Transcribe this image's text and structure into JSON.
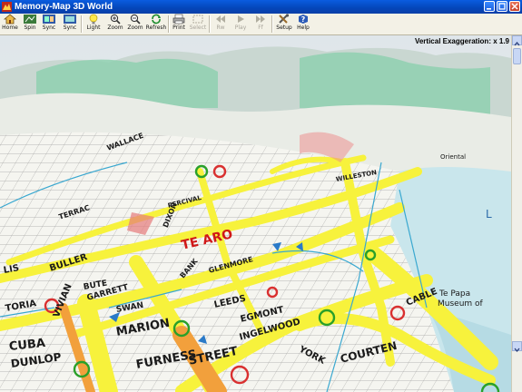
{
  "window": {
    "title": "Memory-Map 3D World"
  },
  "toolbar": {
    "buttons": [
      {
        "label": "Home",
        "icon": "home-icon",
        "enabled": true
      },
      {
        "label": "Spin",
        "icon": "spin-icon",
        "enabled": true
      },
      {
        "label": "Sync",
        "icon": "sync-icon",
        "enabled": true
      },
      {
        "label": "Sync",
        "icon": "sync-icon",
        "enabled": true
      },
      {
        "label": "Light",
        "icon": "light-bulb-icon",
        "enabled": true
      },
      {
        "label": "Zoom",
        "icon": "zoom-in-icon",
        "enabled": true
      },
      {
        "label": "Zoom",
        "icon": "zoom-out-icon",
        "enabled": true
      },
      {
        "label": "Refresh",
        "icon": "refresh-icon",
        "enabled": true
      },
      {
        "label": "Print",
        "icon": "print-icon",
        "enabled": true
      },
      {
        "label": "Select",
        "icon": "select-icon",
        "enabled": false
      },
      {
        "label": "Rw",
        "icon": "rewind-icon",
        "enabled": false
      },
      {
        "label": "Play",
        "icon": "play-icon",
        "enabled": false
      },
      {
        "label": "Ff",
        "icon": "fast-forward-icon",
        "enabled": false
      },
      {
        "label": "Setup",
        "icon": "setup-icon",
        "enabled": true
      },
      {
        "label": "Help",
        "icon": "help-icon",
        "enabled": true
      }
    ]
  },
  "map": {
    "vertical_exaggeration": "Vertical Exaggeration: x 1.9",
    "labels": {
      "te_aro": "TE ARO",
      "buller": "BULLER",
      "cuba": "CUBA",
      "dunlop": "DUNLOP",
      "marion": "MARION",
      "furness": "FURNESS",
      "street": "STREET",
      "vivian": "VIVIAN",
      "ingelwood": "INGELWOOD",
      "courtenay": "COURTEN",
      "york": "YORK",
      "egmont": "EGMONT",
      "swan": "SWAN",
      "garrett": "GARRETT",
      "cable": "CABLE",
      "te_papa": "Te Papa",
      "museum": "Museum of",
      "leeds": "LEEDS",
      "bute": "BUTE",
      "toria": "TORIA",
      "lis": "LIS",
      "terrace": "TERRAC",
      "dixon": "DIXON",
      "percival": "PERCIVAL",
      "bank": "BANK",
      "glenmore": "GLENMORE",
      "wallace": "WALLACE",
      "willeston": "WILLESTON",
      "oriental": "Oriental",
      "lsd": "L"
    }
  },
  "colors": {
    "titlebar": "#0a4fd0",
    "road_major": "#f7f23c",
    "road_highway": "#f2a03c",
    "water": "#c9e6ec",
    "hills": "#8fd0b0",
    "route_marker": "#d93030"
  }
}
